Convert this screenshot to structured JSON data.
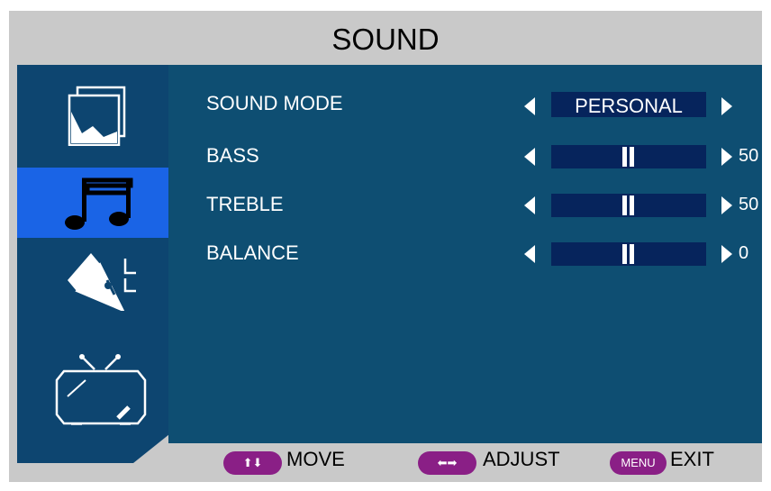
{
  "title": "SOUND",
  "sidebar": {
    "items": [
      {
        "name": "picture",
        "icon": "picture-icon",
        "active": false
      },
      {
        "name": "sound",
        "icon": "music-note-icon",
        "active": true
      },
      {
        "name": "setup",
        "icon": "pen-icon",
        "active": false
      },
      {
        "name": "tv",
        "icon": "tv-icon",
        "active": false
      }
    ]
  },
  "settings": {
    "sound_mode": {
      "label": "SOUND MODE",
      "value": "PERSONAL"
    },
    "bass": {
      "label": "BASS",
      "value": "50"
    },
    "treble": {
      "label": "TREBLE",
      "value": "50"
    },
    "balance": {
      "label": "BALANCE",
      "value": "0"
    }
  },
  "footer": {
    "move": {
      "key": "⬆⬇",
      "label": "MOVE"
    },
    "adjust": {
      "key": "⬅➡",
      "label": "ADJUST"
    },
    "exit": {
      "key": "MENU",
      "label": "EXIT"
    }
  },
  "colors": {
    "panel": "#0e4e72",
    "sidebar": "#0d4570",
    "active": "#1a64e6",
    "frame": "#c9c9c9",
    "value_box": "#06245c",
    "key_pill": "#8a1f86"
  }
}
